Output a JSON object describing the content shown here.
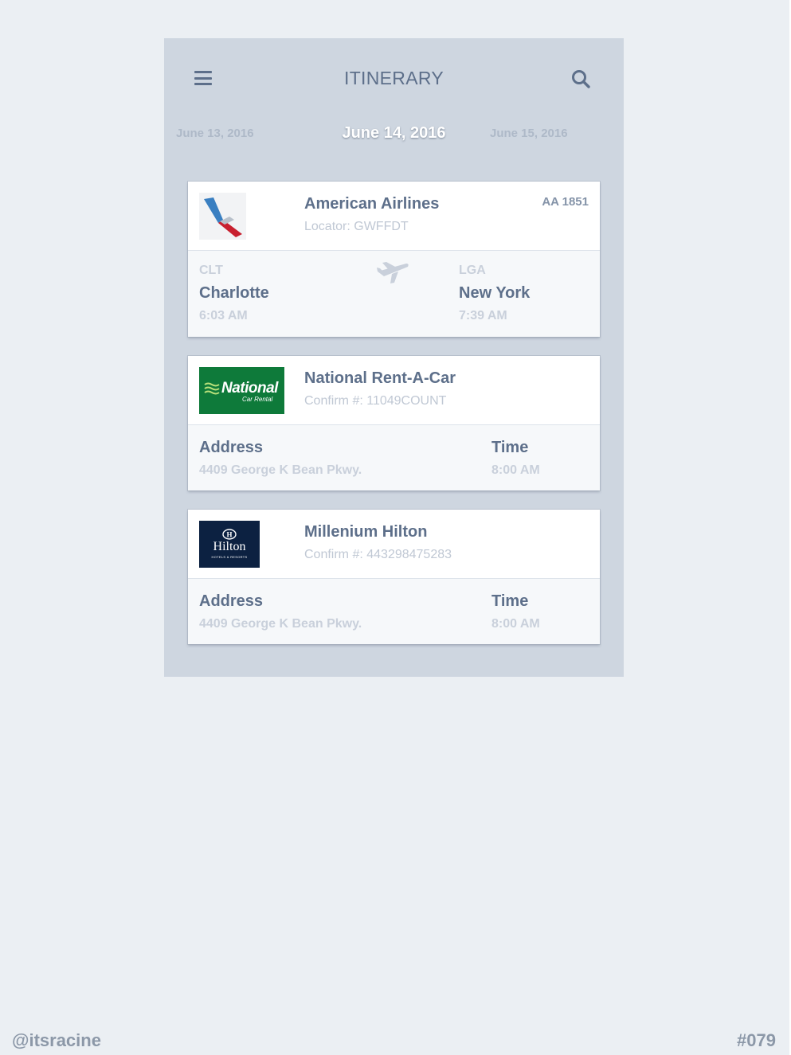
{
  "header": {
    "title": "ITINERARY",
    "menu_icon": "hamburger-menu-icon",
    "search_icon": "search-icon"
  },
  "dates": {
    "previous": "June 13, 2016",
    "current": "June 14, 2016",
    "next": "June 15, 2016"
  },
  "flight": {
    "airline": "American Airlines",
    "locator": "Locator: GWFFDT",
    "flight_number": "AA 1851",
    "logo_icon": "american-airlines-logo",
    "route_icon": "airplane-icon",
    "origin": {
      "code": "CLT",
      "city": "Charlotte",
      "time": "6:03 AM"
    },
    "destination": {
      "code": "LGA",
      "city": "New York",
      "time": "7:39 AM"
    }
  },
  "car_rental": {
    "name": "National Rent-A-Car",
    "confirmation": "Confirm #: 11049COUNT",
    "logo_text": "National",
    "logo_subtext": "Car Rental",
    "address_label": "Address",
    "address": "4409 George K Bean Pkwy.",
    "time_label": "Time",
    "time": "8:00 AM",
    "brand_color": "#0e7a3a"
  },
  "hotel": {
    "name": "Millenium Hilton",
    "confirmation": "Confirm #: 443298475283",
    "logo_text": "Hilton",
    "logo_subtext": "HOTELS & RESORTS",
    "address_label": "Address",
    "address": "4409 George K Bean Pkwy.",
    "time_label": "Time",
    "time": "8:00 AM",
    "brand_color": "#0c2141"
  },
  "footer": {
    "handle": "@itsracine",
    "shot_number": "#079"
  },
  "colors": {
    "background": "#ebeff3",
    "panel": "#ced6e0",
    "primary_text": "#5d6f8a",
    "muted_text": "#c0c8d4"
  }
}
